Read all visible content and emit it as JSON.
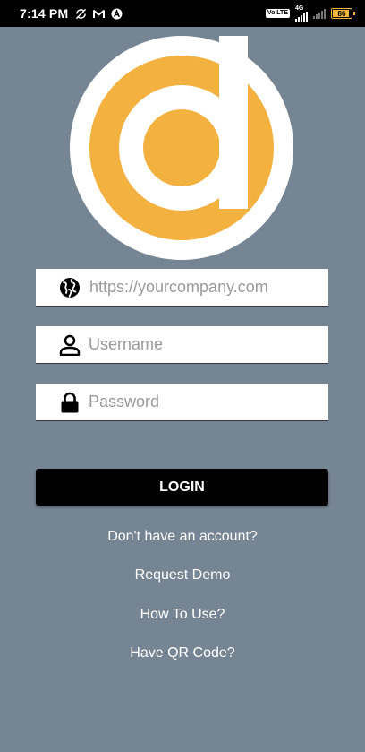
{
  "status_bar": {
    "time": "7:14 PM",
    "network": "4G",
    "volte": "Vo LTE",
    "battery": "86",
    "battery_color": "#f3b63a"
  },
  "theme": {
    "background": "#768594",
    "logo_orange": "#f3b13f",
    "button": "#000000"
  },
  "form": {
    "url_placeholder": "https://yourcompany.com",
    "username_placeholder": "Username",
    "password_placeholder": "Password",
    "login_label": "LOGIN"
  },
  "links": {
    "signup": "Don't have an account?",
    "demo": "Request Demo",
    "how_to": "How To Use?",
    "qr": "Have QR Code?"
  }
}
